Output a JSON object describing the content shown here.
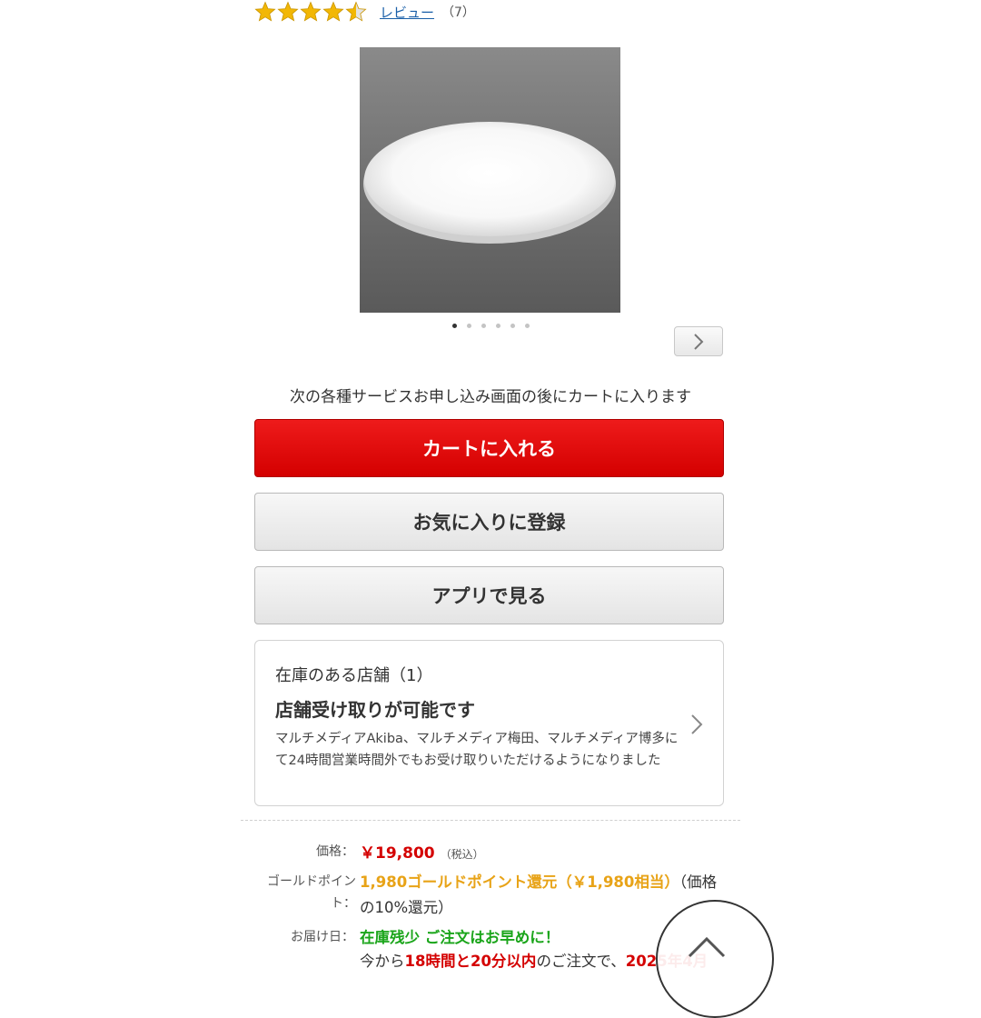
{
  "rating": {
    "value": 4.5,
    "max": 5,
    "review_label": "レビュー",
    "review_count": "（7）"
  },
  "gallery": {
    "image_count": 6,
    "active_index": 0
  },
  "service_note": "次の各種サービスお申し込み画面の後にカートに入ります",
  "buttons": {
    "cart": "カートに入れる",
    "favorite": "お気に入りに登録",
    "app": "アプリで見る"
  },
  "store": {
    "heading": "在庫のある店舗（1）",
    "title": "店舗受け取りが可能です",
    "description": "マルチメディアAkiba、マルチメディア梅田、マルチメディア博多にて24時間営業時間外でもお受け取りいただけるようになりました"
  },
  "price": {
    "label": "価格：",
    "value": "￥19,800",
    "tax": "（税込）"
  },
  "points": {
    "label": "ゴールドポイント：",
    "highlight": "1,980ゴールドポイント還元（￥1,980相当）",
    "suffix": "（価格の10%還元）"
  },
  "delivery": {
    "label": "お届け日：",
    "status": "在庫残少 ご注文はお早めに！",
    "line_prefix": "今から",
    "line_time": "18時間と20分以内",
    "line_middle": "のご注文で、",
    "line_date": "2025年4月"
  },
  "colors": {
    "cart_red": "#d40000",
    "gold": "#e8a317",
    "stock_green": "#1aa51a",
    "link_blue": "#1a5fa8"
  },
  "icons": {
    "star": "star-icon",
    "next": "chevron-right-icon",
    "store": "chevron-right-icon",
    "top": "chevron-up-icon"
  }
}
